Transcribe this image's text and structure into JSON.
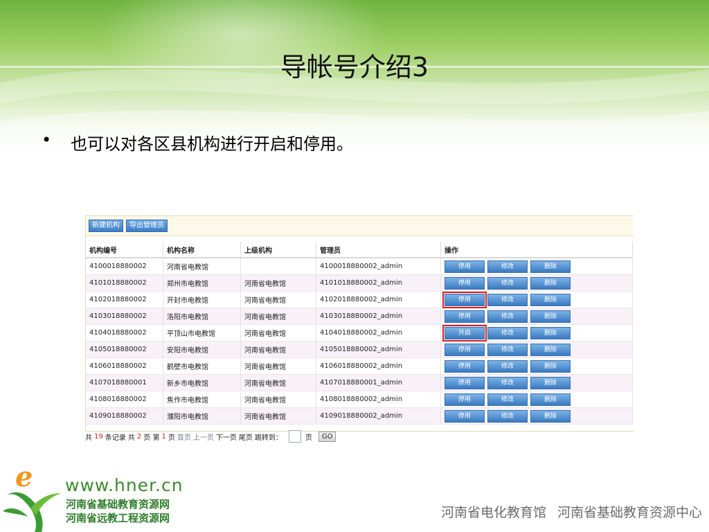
{
  "slide": {
    "title": "导帐号介绍3",
    "bullet": "•",
    "bullet_text": "也可以对各区县机构进行开启和停用。"
  },
  "toolbar": {
    "new_org_label": "新建机构",
    "export_admin_label": "导出管理员"
  },
  "table": {
    "headers": [
      "机构编号",
      "机构名称",
      "上级机构",
      "管理员",
      "操作"
    ],
    "rows": [
      {
        "code": "4100018880002",
        "name": "河南省电教馆",
        "parent": "",
        "admin": "4100018880002_admin",
        "toggle": "停用"
      },
      {
        "code": "4101018880002",
        "name": "郑州市电教馆",
        "parent": "河南省电教馆",
        "admin": "4101018880002_admin",
        "toggle": "停用"
      },
      {
        "code": "4102018880002",
        "name": "开封市电教馆",
        "parent": "河南省电教馆",
        "admin": "4102018880002_admin",
        "toggle": "停用"
      },
      {
        "code": "4103018880002",
        "name": "洛阳市电教馆",
        "parent": "河南省电教馆",
        "admin": "4103018880002_admin",
        "toggle": "停用"
      },
      {
        "code": "4104018880002",
        "name": "平顶山市电教馆",
        "parent": "河南省电教馆",
        "admin": "4104018880002_admin",
        "toggle": "开启"
      },
      {
        "code": "4105018880002",
        "name": "安阳市电教馆",
        "parent": "河南省电教馆",
        "admin": "4105018880002_admin",
        "toggle": "停用"
      },
      {
        "code": "4106018880002",
        "name": "鹤壁市电教馆",
        "parent": "河南省电教馆",
        "admin": "4106018880002_admin",
        "toggle": "停用"
      },
      {
        "code": "4107018880001",
        "name": "新乡市电教馆",
        "parent": "河南省电教馆",
        "admin": "4107018880001_admin",
        "toggle": "停用"
      },
      {
        "code": "4108018880002",
        "name": "焦作市电教馆",
        "parent": "河南省电教馆",
        "admin": "4108018880002_admin",
        "toggle": "停用"
      },
      {
        "code": "4109018880002",
        "name": "濮阳市电教馆",
        "parent": "河南省电教馆",
        "admin": "4109018880002_admin",
        "toggle": "停用"
      }
    ],
    "edit_label": "修改",
    "delete_label": "删除"
  },
  "pager": {
    "total_prefix": "共",
    "total_records": "19",
    "records_suffix": "条记录 共",
    "total_pages": "2",
    "pages_suffix": "页 第",
    "current_page": "1",
    "page_suffix": "页",
    "first": "首页",
    "prev": "上一页",
    "next": "下一页",
    "last": "尾页",
    "jump_label": "跳转到：",
    "jump_value": "",
    "jump_unit": "页",
    "go_label": "GO"
  },
  "logo": {
    "mark": "e",
    "url": "www.hner.cn",
    "line1": "河南省基础教育资源网",
    "line2": "河南省远教工程资源网"
  },
  "footer": {
    "org1": "河南省电化教育馆",
    "org2": "河南省基础教育资源中心"
  },
  "colors": {
    "header_green": "#6fb43f",
    "button_blue": "#3d7fc6",
    "highlight_red": "#d42020",
    "logo_green": "#3d8a2b",
    "logo_orange": "#f0961e"
  }
}
